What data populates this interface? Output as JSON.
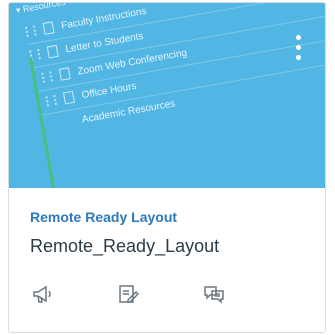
{
  "hero": {
    "section_label": "Resources",
    "items": [
      "Faculty Instructions",
      "Letter to Students",
      "Zoom Web Conferencing",
      "Office Hours",
      "Academic Resources"
    ],
    "accent_color": "#52b6e4",
    "indent_bar_color": "#46c07f"
  },
  "card": {
    "title": "Remote Ready Layout",
    "subtitle": "Remote_Ready_Layout",
    "title_color": "#2b7abc"
  },
  "actions": [
    {
      "name": "announcements",
      "icon": "megaphone-icon"
    },
    {
      "name": "assignments",
      "icon": "edit-document-icon"
    },
    {
      "name": "discussions",
      "icon": "chat-bubbles-icon"
    }
  ]
}
